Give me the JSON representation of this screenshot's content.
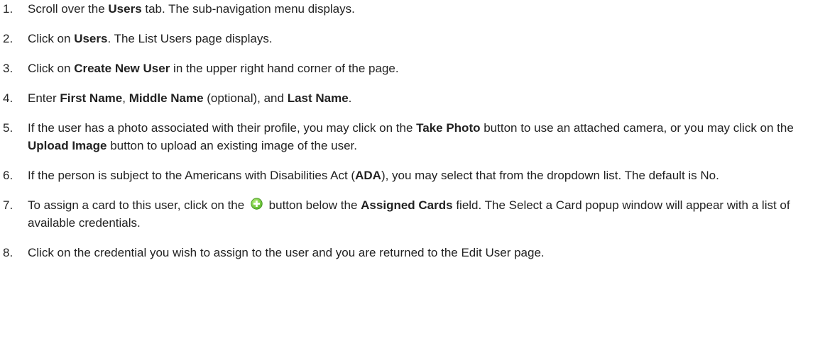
{
  "steps": [
    {
      "num": "1.",
      "parts": [
        {
          "t": "Scroll over the "
        },
        {
          "t": "Users",
          "b": true
        },
        {
          "t": " tab. The sub-navigation menu displays."
        }
      ]
    },
    {
      "num": "2.",
      "parts": [
        {
          "t": "Click on "
        },
        {
          "t": "Users",
          "b": true
        },
        {
          "t": ". The List Users page displays."
        }
      ]
    },
    {
      "num": "3.",
      "parts": [
        {
          "t": "Click on "
        },
        {
          "t": "Create New User",
          "b": true
        },
        {
          "t": " in the upper right hand corner of the page."
        }
      ]
    },
    {
      "num": "4.",
      "parts": [
        {
          "t": " Enter "
        },
        {
          "t": "First Name",
          "b": true
        },
        {
          "t": ", "
        },
        {
          "t": "Middle Name",
          "b": true
        },
        {
          "t": " (optional), and "
        },
        {
          "t": "Last Name",
          "b": true
        },
        {
          "t": "."
        }
      ]
    },
    {
      "num": "5.",
      "parts": [
        {
          "t": "If the user has a photo associated with their profile, you may click on the "
        },
        {
          "t": "Take Photo",
          "b": true
        },
        {
          "t": " button to use an attached camera, or you may click on the "
        },
        {
          "t": "Upload Image",
          "b": true
        },
        {
          "t": " button to upload an existing image of the user."
        }
      ]
    },
    {
      "num": "6.",
      "parts": [
        {
          "t": "If the person is subject to the Americans with Disabilities Act ("
        },
        {
          "t": "ADA",
          "b": true
        },
        {
          "t": "), you may select that from the dropdown list. The default is No."
        }
      ]
    },
    {
      "num": "7.",
      "parts": [
        {
          "t": "To assign a card to this user, click on the "
        },
        {
          "icon": "green-plus-icon"
        },
        {
          "t": " button below the "
        },
        {
          "t": "Assigned Cards",
          "b": true
        },
        {
          "t": " field. The Select a Card popup window will appear with a list of available credentials."
        }
      ]
    },
    {
      "num": "8.",
      "parts": [
        {
          "t": "Click on the credential you wish to assign to the user and you are returned to the Edit User page."
        }
      ]
    }
  ],
  "colors": {
    "text": "#222222",
    "icon_green": "#5cb82e",
    "icon_plus": "#ffffff"
  }
}
